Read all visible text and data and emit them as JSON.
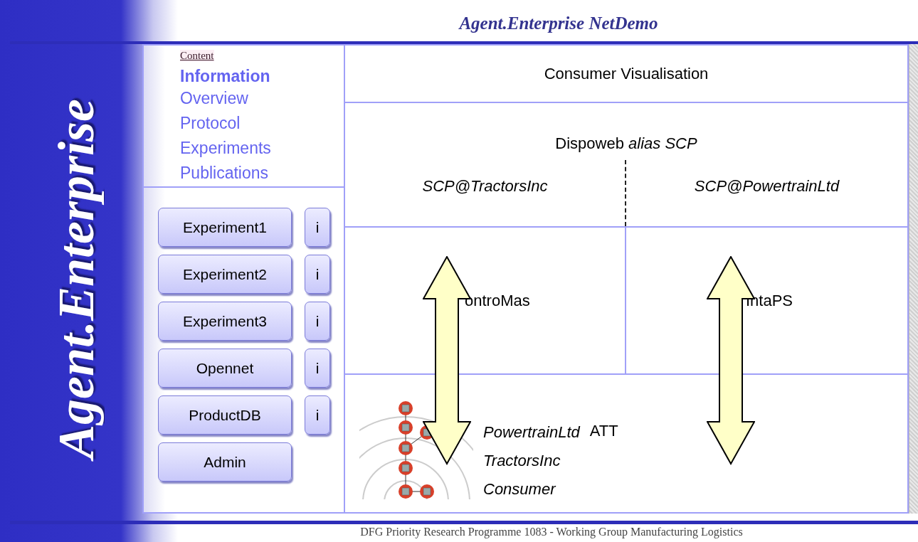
{
  "header": {
    "title": "Agent.Enterprise NetDemo"
  },
  "sidebar": {
    "logo": "Agent.Enterprise"
  },
  "nav": {
    "heading": "Content",
    "section": "Information",
    "links": [
      "Overview",
      "Protocol",
      "Experiments",
      "Publications"
    ]
  },
  "buttons": [
    {
      "label": "Experiment1",
      "info": "i"
    },
    {
      "label": "Experiment2",
      "info": "i"
    },
    {
      "label": "Experiment3",
      "info": "i"
    },
    {
      "label": "Opennet",
      "info": "i"
    },
    {
      "label": "ProductDB",
      "info": "i"
    },
    {
      "label": "Admin"
    }
  ],
  "diagram": {
    "consumer": "Consumer Visualisation",
    "dispoweb": "Dispoweb *alias SCP*",
    "scp": [
      "SCP@TractorsInc",
      "SCP@PowertrainLtd"
    ],
    "agents": [
      "ontroMas",
      "IntaPS"
    ],
    "att_labels": [
      "PowertrainLtd",
      "TractorsInc",
      "Consumer"
    ],
    "att": "ATT"
  },
  "footer": "DFG Priority Research Programme 1083 - Working Group Manufacturing Logistics"
}
